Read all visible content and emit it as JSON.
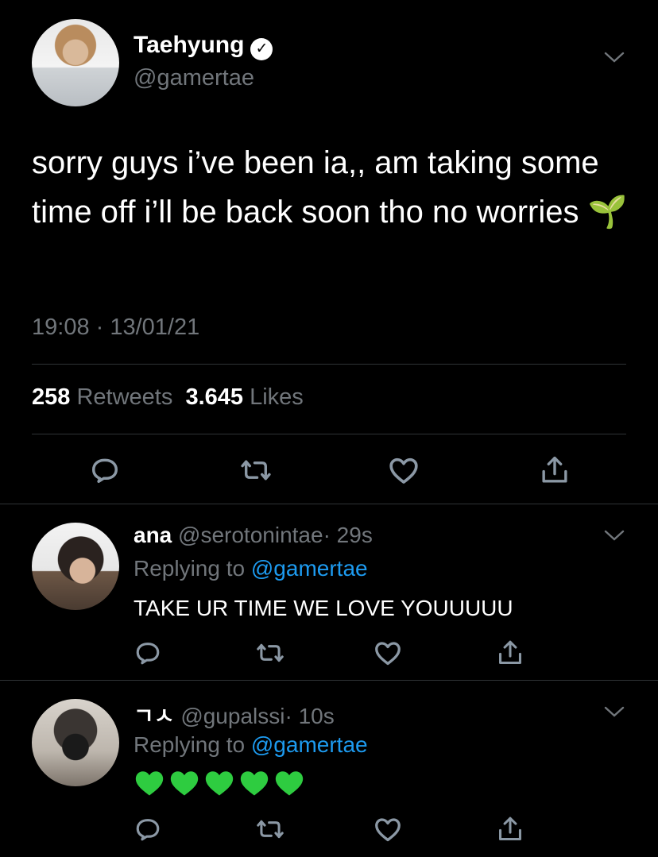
{
  "main_tweet": {
    "author_name": "Taehyung",
    "handle": "@gamertae",
    "verified_mark": "✓",
    "text": "sorry guys i’ve been ia,, am taking some time off i’ll be back soon tho no worries 🌱",
    "timestamp": "19:08 · 13/01/21",
    "retweets_count": "258",
    "retweets_label": "Retweets",
    "likes_count": "3.645",
    "likes_label": "Likes"
  },
  "replies": [
    {
      "author_name": "ana",
      "handle": "@serotonintae",
      "age": "· 29s",
      "replying_prefix": "Replying to",
      "replying_to": "@gamertae",
      "text": "TAKE UR TIME WE LOVE YOUUUUU"
    },
    {
      "author_name": "ㄱㅅ",
      "handle": "@gupalssi",
      "age": "· 10s",
      "replying_prefix": "Replying to",
      "replying_to": "@gamertae",
      "hearts": 5
    }
  ],
  "icons": {
    "reply": "reply-icon",
    "retweet": "retweet-icon",
    "like": "heart-icon",
    "share": "share-icon",
    "more": "chevron-down-icon",
    "verified": "verified-badge-icon",
    "heart_emoji": "green-heart-icon"
  },
  "colors": {
    "background": "#000000",
    "muted_text": "#71767b",
    "link": "#1d9bf0",
    "green_heart": "#2ecc40"
  }
}
